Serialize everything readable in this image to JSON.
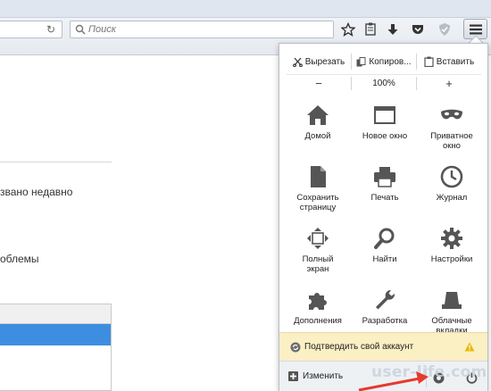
{
  "toolbar": {
    "search_placeholder": "Поиск",
    "icons": [
      "reload-icon",
      "search-icon",
      "bookmark-star-icon",
      "reading-list-icon",
      "downloads-icon",
      "pocket-icon",
      "shield-icon",
      "hamburger-menu-icon"
    ]
  },
  "page": {
    "text1": "звано недавно",
    "text2": "облемы"
  },
  "menu": {
    "edit": {
      "cut": "Вырезать",
      "copy": "Копиров...",
      "paste": "Вставить"
    },
    "zoom": {
      "minus": "−",
      "value": "100%",
      "plus": "+"
    },
    "items": [
      {
        "label": "Домой",
        "icon": "home-icon"
      },
      {
        "label": "Новое окно",
        "icon": "new-window-icon"
      },
      {
        "label": "Приватное\nокно",
        "icon": "private-mask-icon"
      },
      {
        "label": "Сохранить\nстраницу",
        "icon": "save-page-icon"
      },
      {
        "label": "Печать",
        "icon": "print-icon"
      },
      {
        "label": "Журнал",
        "icon": "history-clock-icon"
      },
      {
        "label": "Полный\nэкран",
        "icon": "fullscreen-icon"
      },
      {
        "label": "Найти",
        "icon": "find-icon"
      },
      {
        "label": "Настройки",
        "icon": "settings-gear-icon"
      },
      {
        "label": "Дополнения",
        "icon": "addons-puzzle-icon"
      },
      {
        "label": "Разработка",
        "icon": "developer-wrench-icon"
      },
      {
        "label": "Облачные\nвкладки",
        "icon": "synced-tabs-icon"
      }
    ],
    "sync": {
      "label": "Подтвердить свой аккаунт"
    },
    "footer": {
      "customize": "Изменить"
    }
  },
  "watermark": "user-life.com",
  "colors": {
    "selection": "#3d8ee0",
    "sync_bar": "#fbefc4",
    "warning": "#e9b800",
    "arrow": "#e53a2f"
  }
}
